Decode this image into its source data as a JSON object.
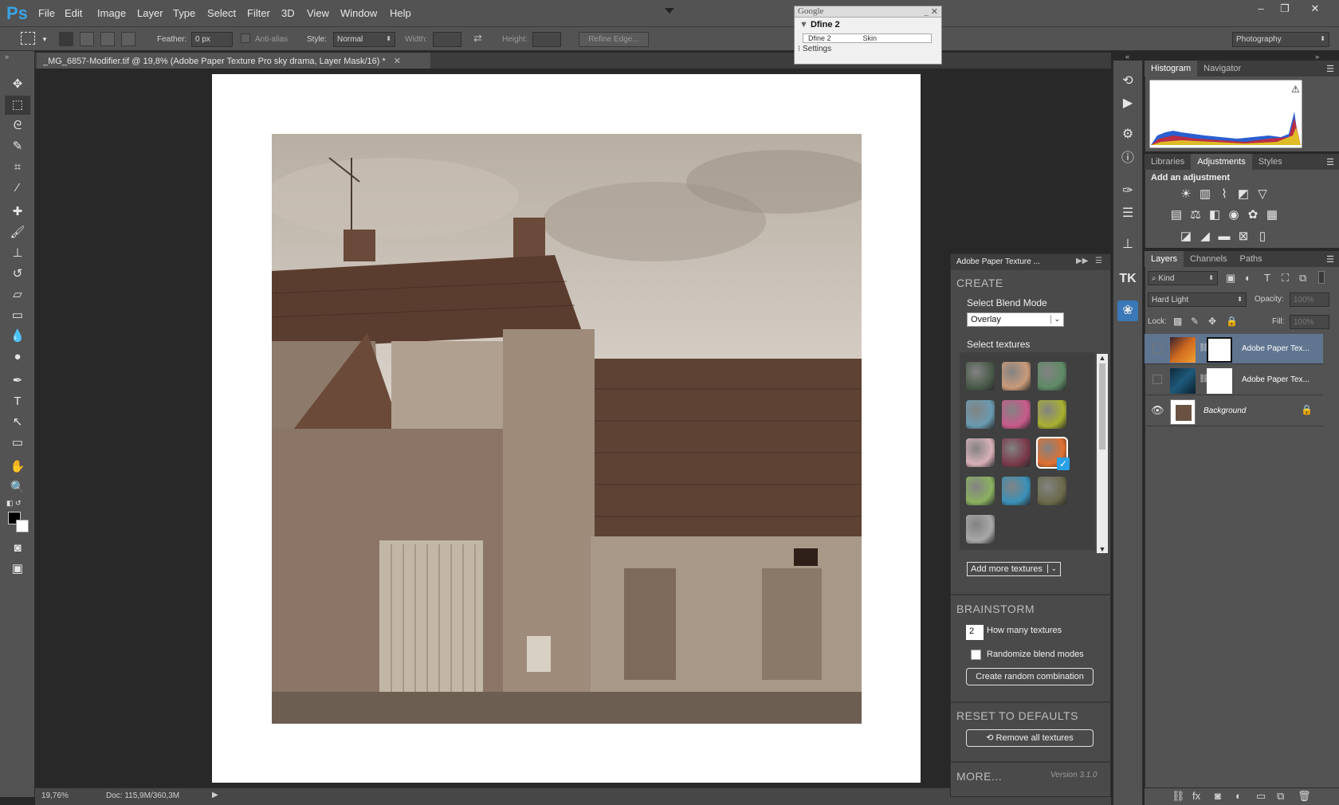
{
  "app": {
    "logo": "Ps"
  },
  "menu": [
    "File",
    "Edit",
    "Image",
    "Layer",
    "Type",
    "Select",
    "Filter",
    "3D",
    "View",
    "Window",
    "Help"
  ],
  "options": {
    "feather_label": "Feather:",
    "feather_value": "0 px",
    "antialias_label": "Anti-alias",
    "style_label": "Style:",
    "style_value": "Normal",
    "width_label": "Width:",
    "height_label": "Height:",
    "refine_label": "Refine Edge...",
    "workspace": "Photography"
  },
  "document": {
    "tab_title": "_MG_6857-Modifier.tif @ 19,8% (Adobe Paper Texture Pro sky drama, Layer Mask/16) *",
    "zoom": "19,76%",
    "doc_info": "Doc: 115,9M/360,3M"
  },
  "google_window": {
    "title": "Google",
    "plugin": "Dfine 2",
    "col1": "Dfine 2",
    "col2": "Skin",
    "footer": "Settings"
  },
  "histogram": {
    "tabs": [
      "Histogram",
      "Navigator"
    ]
  },
  "adjustments": {
    "tabs": [
      "Libraries",
      "Adjustments",
      "Styles"
    ],
    "title": "Add an adjustment"
  },
  "layers": {
    "tabs": [
      "Layers",
      "Channels",
      "Paths"
    ],
    "kind_label": "Kind",
    "blend_mode": "Hard Light",
    "opacity_label": "Opacity:",
    "opacity_value": "100%",
    "lock_label": "Lock:",
    "fill_label": "Fill:",
    "fill_value": "100%",
    "items": [
      {
        "name": "Adobe Paper Tex...",
        "selected": true,
        "visible": false
      },
      {
        "name": "Adobe Paper Tex...",
        "selected": false,
        "visible": false
      },
      {
        "name": "Background",
        "selected": false,
        "visible": true,
        "locked": true
      }
    ]
  },
  "apt": {
    "title": "Adobe Paper Texture ...",
    "create": "CREATE",
    "blend_label": "Select Blend Mode",
    "blend_value": "Overlay",
    "textures_label": "Select textures",
    "add_more": "Add more textures",
    "brainstorm": "BRAINSTORM",
    "count": "2",
    "count_label": "How many textures",
    "randomize": "Randomize blend modes",
    "random_btn": "Create random combination",
    "reset": "RESET TO DEFAULTS",
    "remove_btn": "Remove all textures",
    "more": "MORE...",
    "version": "Version 3.1.0",
    "swatches": [
      "#4a5a4a",
      "#c99a7a",
      "#5e8a66",
      "#6a9ab0",
      "#c85a8a",
      "#a8b030",
      "#d8b0b8",
      "#7a3a4a",
      "#e07030",
      "#8ab060",
      "#3a90b8",
      "#6a6a4a",
      "#a8a8a8"
    ]
  },
  "colors": {
    "accent": "#3aa3e6",
    "selected_layer": "#5f7590"
  }
}
